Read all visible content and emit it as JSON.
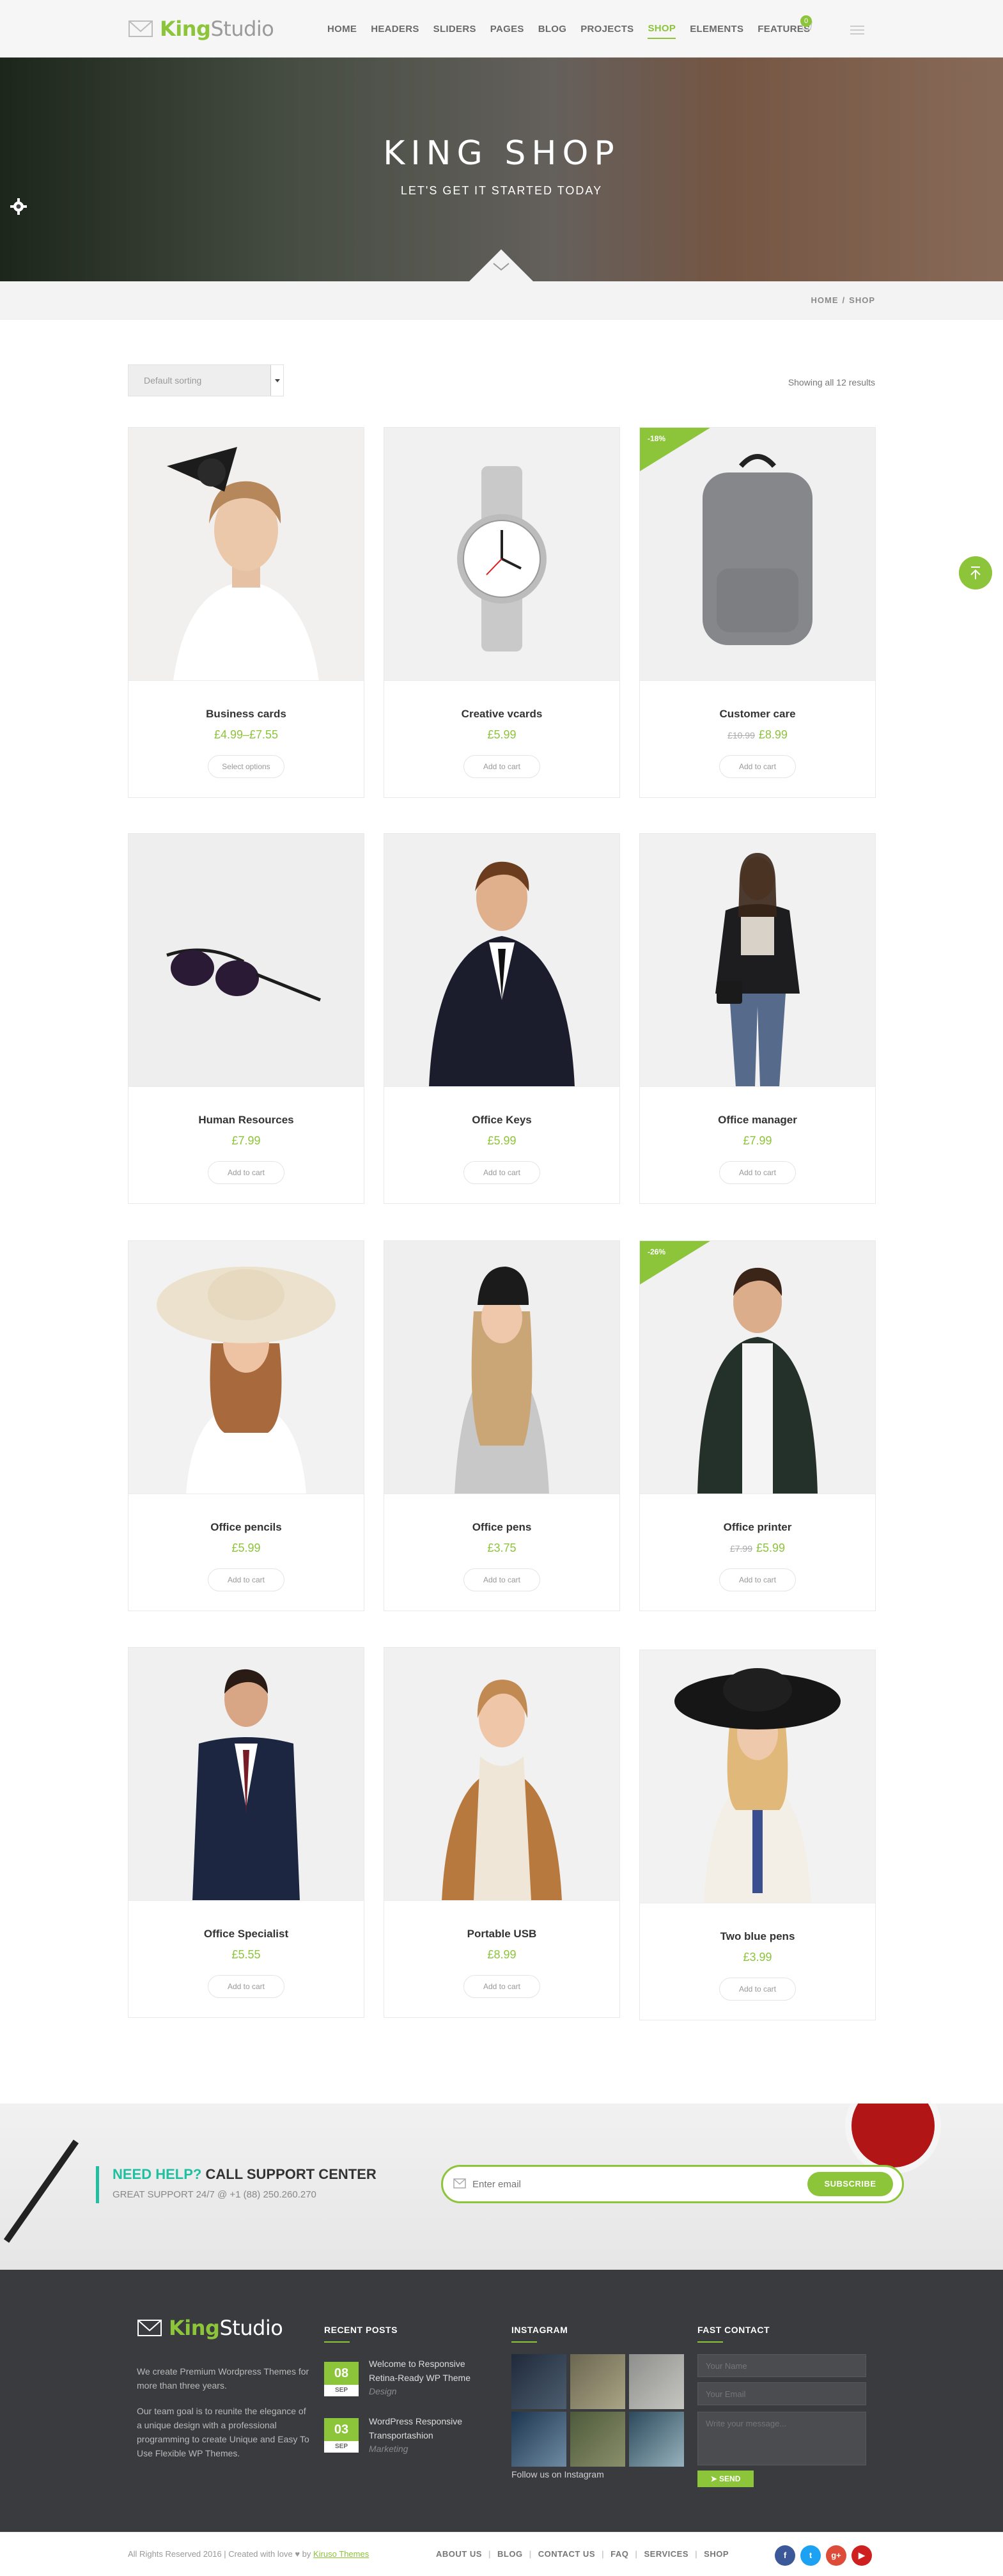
{
  "header": {
    "logo_king": "King",
    "logo_studio": "Studio",
    "nav": [
      "HOME",
      "HEADERS",
      "SLIDERS",
      "PAGES",
      "BLOG",
      "PROJECTS",
      "SHOP",
      "ELEMENTS",
      "FEATURES"
    ],
    "active_nav": "SHOP",
    "cart_count": "0",
    "accent": "#8cc43a"
  },
  "hero": {
    "title": "KING SHOP",
    "subtitle": "LET'S GET IT STARTED TODAY"
  },
  "breadcrumb": {
    "home": "HOME",
    "current": "SHOP"
  },
  "shop": {
    "sort_label": "Default sorting",
    "results_text": "Showing all 12 results",
    "products": [
      {
        "name": "Business cards",
        "price": "£4.99–£7.55",
        "old_price": "",
        "button": "Select options",
        "sale": ""
      },
      {
        "name": "Creative vcards",
        "price": "£5.99",
        "old_price": "",
        "button": "Add to cart",
        "sale": ""
      },
      {
        "name": "Customer care",
        "price": "£8.99",
        "old_price": "£10.99",
        "button": "Add to cart",
        "sale": "-18%"
      },
      {
        "name": "Human Resources",
        "price": "£7.99",
        "old_price": "",
        "button": "Add to cart",
        "sale": ""
      },
      {
        "name": "Office Keys",
        "price": "£5.99",
        "old_price": "",
        "button": "Add to cart",
        "sale": ""
      },
      {
        "name": "Office manager",
        "price": "£7.99",
        "old_price": "",
        "button": "Add to cart",
        "sale": ""
      },
      {
        "name": "Office pencils",
        "price": "£5.99",
        "old_price": "",
        "button": "Add to cart",
        "sale": ""
      },
      {
        "name": "Office pens",
        "price": "£3.75",
        "old_price": "",
        "button": "Add to cart",
        "sale": ""
      },
      {
        "name": "Office printer",
        "price": "£5.99",
        "old_price": "£7.99",
        "button": "Add to cart",
        "sale": "-26%"
      },
      {
        "name": "Office Specialist",
        "price": "£5.55",
        "old_price": "",
        "button": "Add to cart",
        "sale": ""
      },
      {
        "name": "Portable USB",
        "price": "£8.99",
        "old_price": "",
        "button": "Add to cart",
        "sale": ""
      },
      {
        "name": "Two blue pens",
        "price": "£3.99",
        "old_price": "",
        "button": "Add to cart",
        "sale": ""
      }
    ]
  },
  "support": {
    "highlight": "NEED HELP?",
    "headline": "CALL SUPPORT CENTER",
    "sub": "GREAT SUPPORT 24/7 @ +1 (88) 250.260.270",
    "email_placeholder": "Enter email",
    "subscribe_label": "SUBSCRIBE"
  },
  "footer": {
    "logo_king": "King",
    "logo_studio": "Studio",
    "about_1": "We create Premium Wordpress Themes for more than three years.",
    "about_2": "Our team goal is to reunite the elegance of a unique design with a professional programming to create Unique and Easy To Use Flexible WP Themes.",
    "recent_posts_title": "RECENT POSTS",
    "posts": [
      {
        "day": "08",
        "month": "SEP",
        "title": "Welcome to Responsive Retina-Ready WP Theme",
        "category": "Design"
      },
      {
        "day": "03",
        "month": "SEP",
        "title": "WordPress Responsive Transportashion",
        "category": "Marketing"
      }
    ],
    "instagram_title": "INSTAGRAM",
    "instagram_link": "Follow us on Instagram",
    "contact_title": "FAST CONTACT",
    "name_placeholder": "Your Name",
    "email_placeholder": "Your Email",
    "message_placeholder": "Write your message...",
    "send_label": "SEND",
    "copyright_text": "All Rights Reserved 2016 | Created with love ♥ by",
    "copyright_link": "Kiruso Themes",
    "links": [
      "ABOUT US",
      "BLOG",
      "CONTACT US",
      "FAQ",
      "SERVICES",
      "SHOP"
    ],
    "social": [
      {
        "icon": "facebook-icon",
        "glyph": "f",
        "color": "#3b5998"
      },
      {
        "icon": "twitter-icon",
        "glyph": "t",
        "color": "#1da1f2"
      },
      {
        "icon": "google-plus-icon",
        "glyph": "g+",
        "color": "#dd4b39"
      },
      {
        "icon": "youtube-icon",
        "glyph": "▶",
        "color": "#cd201f"
      }
    ]
  }
}
